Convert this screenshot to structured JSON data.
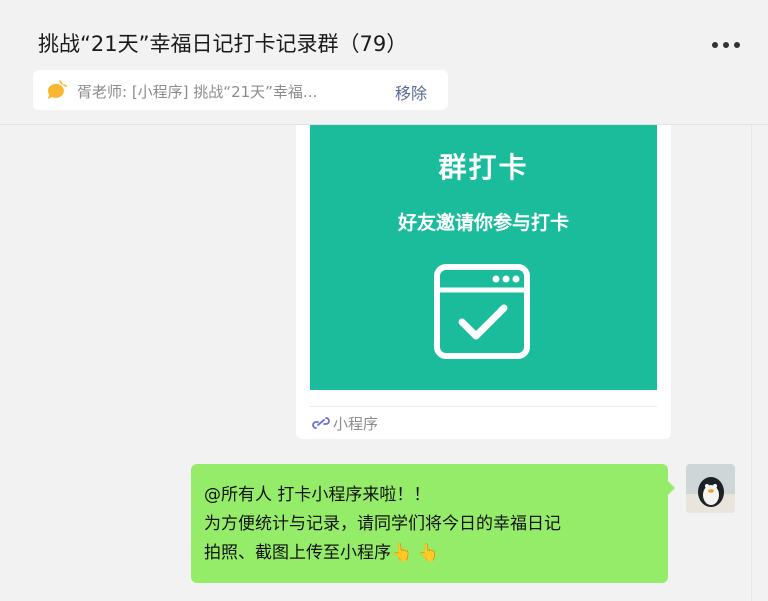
{
  "header": {
    "title": "挑战“21天”幸福日记打卡记录群（79）"
  },
  "pinned": {
    "icon": "chat-bubble-icon",
    "text": "胥老师: [小程序] 挑战“21天”幸福...",
    "remove_label": "移除"
  },
  "messages": [
    {
      "type": "mini_program",
      "card_title": "群打卡",
      "card_subtitle": "好友邀请你参与打卡",
      "card_icon": "checkbox-window-icon",
      "footer_label": "小程序",
      "footer_icon": "mini-program-link-icon",
      "card_color": "#1bbc9b"
    },
    {
      "type": "text",
      "from": "self",
      "lines": [
        "@所有人 打卡小程序来啦！！",
        "为方便统计与记录，请同学们将今日的幸福日记",
        "拍照、截图上传至小程序"
      ],
      "emoji": "👆 👆",
      "bubble_color": "#95ec69"
    }
  ],
  "colors": {
    "background": "#f2f2f2",
    "link_blue": "#576b95",
    "muted": "#8c8c8c"
  }
}
